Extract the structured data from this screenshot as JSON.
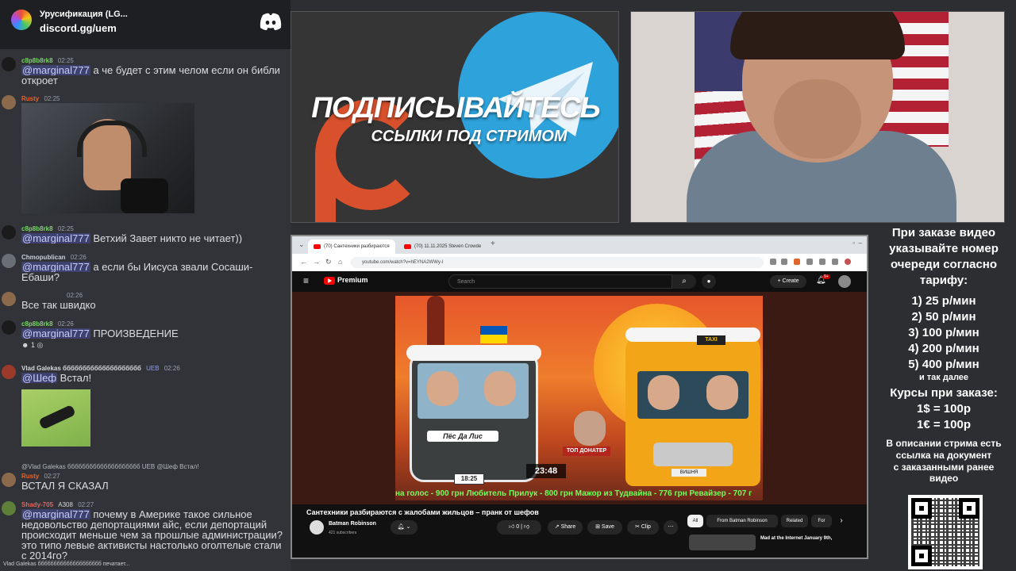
{
  "chat": {
    "server_name": "Урусификация (LG...",
    "server_link": "discord.gg/uem",
    "messages": [
      {
        "user": "c8p8b8rk8",
        "user_color": "#7bd36a",
        "time": "02:25",
        "mention": "@marginal777",
        "text": " а че будет с этим челом если он библи",
        "text2": "откроет"
      },
      {
        "user": "Rusty",
        "user_color": "#e8622a",
        "time": "02:25"
      },
      {
        "user": "c8p8b8rk8",
        "user_color": "#7bd36a",
        "time": "02:25",
        "mention": "@marginal777",
        "text": " Ветхий Завет никто не читает))"
      },
      {
        "user": "Chmopublican",
        "user_color": "#c8ccd4",
        "time": "02:26",
        "mention": "@marginal777",
        "text": " а если бы Иисуса звали Сосаши-",
        "text2": "Ебаши?"
      },
      {
        "user": "",
        "user_color": "#c8ccd4",
        "time": "02:26",
        "text": "Все так швидко"
      },
      {
        "user": "c8p8b8rk8",
        "user_color": "#7bd36a",
        "time": "02:26",
        "mention": "@marginal777",
        "text": " ПРОИЗВЕДЕНИЕ",
        "reaction_count": "1"
      },
      {
        "user": "Vlad Galekas бббббббббббббббббббб",
        "user_color": "#d4d7dc",
        "tag": "UEB",
        "time": "02:26",
        "mention": "@Шеф",
        "text": " Встал!"
      },
      {
        "user": "Rusty",
        "user_color": "#e8622a",
        "time": "02:27",
        "reply": "@Vlad Galekas бббббббббббббббббббб UEB @Шеф Встал!",
        "text": "ВСТАЛ Я СКАЗАЛ"
      },
      {
        "user": "Shady-705",
        "user_color": "#e0675f",
        "tag": "A308",
        "time": "02:27",
        "mention": "@marginal777",
        "text": " почему в Америке такое сильное",
        "lines": [
          "недовольство депортациями айс, если депортаций",
          "происходит меньше чем за прошлые администрации?",
          "это типо левые активисты настолько оголтелые стали",
          "с 2014го?"
        ]
      }
    ],
    "typing": "Vlad Galekas бббббббббббббббббббб печатает..."
  },
  "promo": {
    "title": "ПОДПИСЫВАЙТЕСЬ",
    "subtitle": "ССЫЛКИ ПОД СТРИМОМ"
  },
  "browser": {
    "tabs": [
      "(70) Сантехники разбираются",
      "(70) 11.11.2025 Steven Crowde"
    ],
    "url": "youtube.com/watch?v=hEYNA2WWy-I",
    "premium": "Premium",
    "search_placeholder": "Search",
    "create_label": "Create",
    "notif_count": "9+",
    "video": {
      "title": "Сантехники разбираются с жалобами жильцов – пранк от шефов",
      "channel": "Batman Robinson",
      "subscribers": "421 subscribers",
      "timer": "23:48",
      "clock": "18:25",
      "sign_left": "Пёс Да Лис",
      "top_donat": "ТОП ДОНАТЕР",
      "plate": "ВИШНЯ",
      "taxi": "TAXI",
      "ticker": "на голос - 900 грн   Любитель Прилук - 800 грн   Мажор из Тудвайна - 776 грн   Ревайзер - 707 г"
    },
    "actions": {
      "likes": "0",
      "share": "Share",
      "save": "Save",
      "clip": "Clip"
    },
    "chips": [
      "All",
      "From Batman Robinson",
      "Related",
      "For"
    ],
    "recommended_title": "Mad at the Internet January 9th,"
  },
  "info": {
    "lines": [
      "При заказе видео",
      "указывайте номер",
      "очереди согласно",
      "тарифу:"
    ],
    "tariffs": [
      "1) 25 р/мин",
      "2) 50 р/мин",
      "3) 100 р/мин",
      "4) 200 р/мин",
      "5) 400 р/мин"
    ],
    "etc": "и так далее",
    "rates_title": "Курсы при заказе:",
    "rates": [
      "1$ = 100р",
      "1€ = 100р"
    ],
    "desc": [
      "В описании стрима есть",
      "ссылка на документ",
      "с заказанными ранее",
      "видео"
    ]
  }
}
